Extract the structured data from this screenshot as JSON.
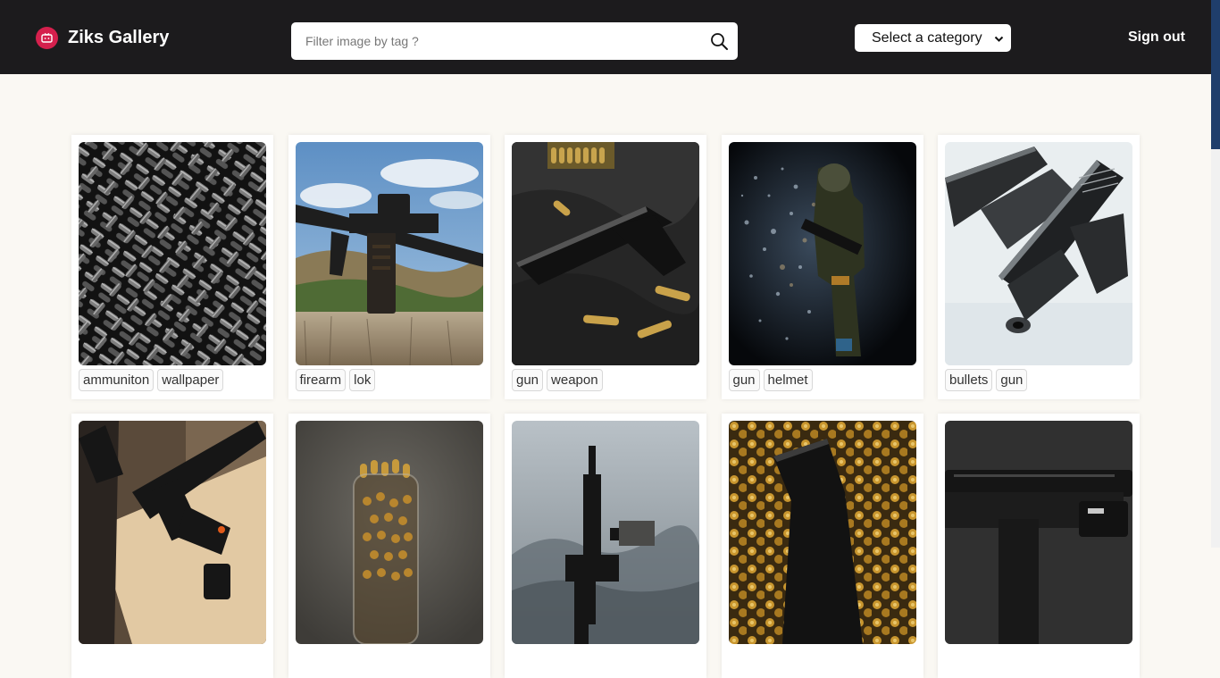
{
  "header": {
    "brand_title": "Ziks Gallery",
    "search_placeholder": "Filter image by tag ?",
    "category_selected": "Select a category",
    "signout_label": "Sign out"
  },
  "gallery": [
    {
      "tags": [
        "ammuniton",
        "wallpaper"
      ],
      "icon": "bullets-pile-photo"
    },
    {
      "tags": [
        "firearm",
        "lok"
      ],
      "icon": "rifle-on-stump-photo"
    },
    {
      "tags": [
        "gun",
        "weapon"
      ],
      "icon": "pistol-on-cloth-photo"
    },
    {
      "tags": [
        "gun",
        "helmet"
      ],
      "icon": "soldier-dispersion-photo"
    },
    {
      "tags": [
        "bullets",
        "gun"
      ],
      "icon": "pistol-disassembled-photo"
    },
    {
      "tags": [],
      "icon": "rifle-on-table-photo"
    },
    {
      "tags": [],
      "icon": "bullets-in-jar-photo"
    },
    {
      "tags": [],
      "icon": "rifle-in-fog-photo"
    },
    {
      "tags": [],
      "icon": "pistol-on-brass-photo"
    },
    {
      "tags": [],
      "icon": "pistol-with-light-photo"
    }
  ],
  "colors": {
    "header_bg": "#1c1b1d",
    "page_bg": "#faf8f3",
    "brand_accent": "#d5204d",
    "scroll_thumb": "#1f3e6b"
  }
}
